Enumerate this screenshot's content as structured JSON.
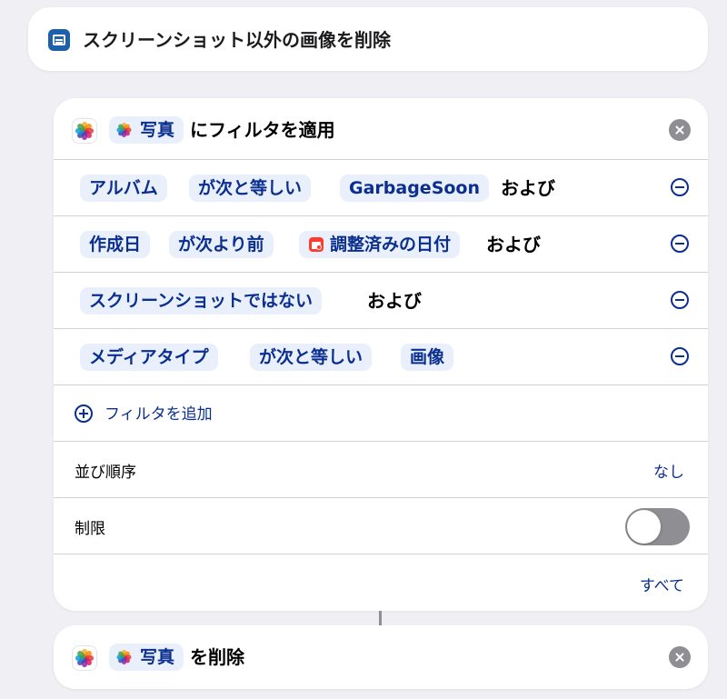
{
  "title_card": {
    "icon": "shortcut-document-icon",
    "title": "スクリーンショット以外の画像を削除"
  },
  "filter_action": {
    "app_icon": "photos-icon",
    "source_label": "写真",
    "action_text": "にフィルタを適用",
    "filters": [
      {
        "parts": [
          "アルバム",
          "が次と等しい",
          "GarbageSoon"
        ],
        "conjunction": "および"
      },
      {
        "parts": [
          "作成日",
          "が次より前",
          "調整済みの日付"
        ],
        "conjunction": "および"
      },
      {
        "parts": [
          "スクリーンショットではない"
        ],
        "conjunction": "および"
      },
      {
        "parts": [
          "メディアタイプ",
          "が次と等しい",
          "画像"
        ],
        "conjunction": ""
      }
    ],
    "add_filter_label": "フィルタを追加",
    "sort_label": "並び順序",
    "sort_value": "なし",
    "limit_label": "制限",
    "limit_enabled": false,
    "get_label": "すべて"
  },
  "delete_action": {
    "app_icon": "photos-icon",
    "source_label": "写真",
    "action_text": "を削除"
  },
  "colors": {
    "accent": "#0b2f8f",
    "pill_background": "#e9f0fc",
    "background": "#efeff4",
    "toggle_off": "#8e8e93"
  }
}
